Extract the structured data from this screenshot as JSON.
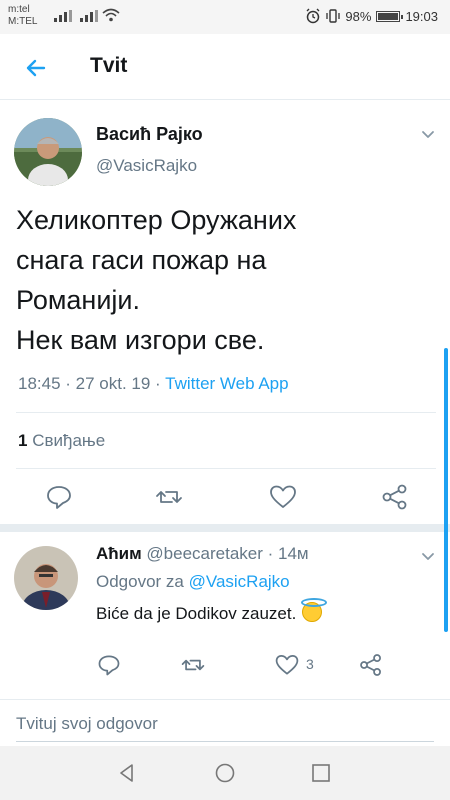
{
  "status_bar": {
    "carrier_1": "m:tel",
    "carrier_2": "M:TEL",
    "battery_level": "98%",
    "battery_fraction": 0.98,
    "time": "19:03"
  },
  "app_bar": {
    "title": "Tvit"
  },
  "tweet": {
    "author_name": "Васић Рајко",
    "author_handle": "@VasicRajko",
    "text_lines": [
      "Хеликоптер Оружаних",
      "снага гаси пожар на",
      "Романији.",
      "Нек вам изгори све."
    ],
    "timestamp": "18:45 · 27 okt. 19 · ",
    "source_app": "Twitter Web App",
    "like_count": "1",
    "like_label": " Свиђање"
  },
  "reply": {
    "author_name": "Аћим",
    "author_handle": " @beecaretaker · 14м",
    "reply_to_label": "Odgovor za ",
    "reply_to_mention": "@VasicRajko",
    "text": "Biće da je Dodikov zauzet.",
    "emoji": "smiling-face-with-halo-emoji",
    "like_count": "3"
  },
  "compose": {
    "placeholder": "Tvituj svoj odgovor"
  },
  "colors": {
    "accent": "#1da1f2",
    "secondary_text": "#657786",
    "divider": "#e6ecf0"
  },
  "icons": [
    "back-arrow-icon",
    "chevron-down-icon",
    "reply-icon",
    "retweet-icon",
    "like-icon",
    "share-icon",
    "nav-back-icon",
    "nav-home-icon",
    "nav-recents-icon",
    "wifi-icon",
    "alarm-icon"
  ]
}
